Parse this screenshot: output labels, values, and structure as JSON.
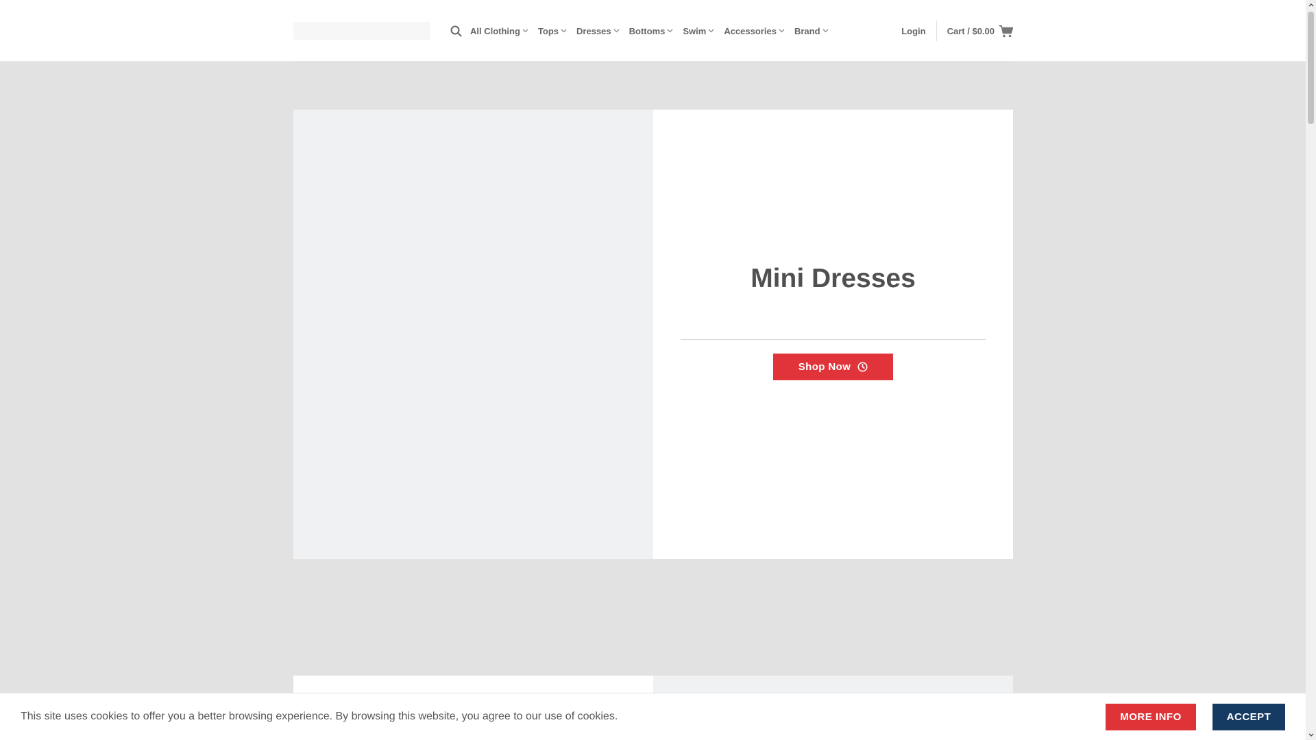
{
  "header": {
    "nav": [
      {
        "label": "All Clothing"
      },
      {
        "label": "Tops"
      },
      {
        "label": "Dresses"
      },
      {
        "label": "Bottoms"
      },
      {
        "label": "Swim"
      },
      {
        "label": "Accessories"
      },
      {
        "label": "Brand"
      }
    ],
    "login_label": "Login",
    "cart_label": "Cart / $0.00"
  },
  "promo": {
    "title": "Mini Dresses",
    "button_label": "Shop Now"
  },
  "cookie": {
    "text": "This site uses cookies to offer you a better browsing experience. By browsing this website, you agree to our use of cookies.",
    "more_info_label": "MORE INFO",
    "accept_label": "ACCEPT"
  },
  "colors": {
    "accent_red": "#e0333a",
    "accept_navy": "#163b63",
    "page_bg": "#e2e2e2"
  },
  "icons": {
    "search": "search-icon",
    "chevron": "chevron-down-icon",
    "cart": "cart-icon",
    "clock": "clock-icon"
  }
}
